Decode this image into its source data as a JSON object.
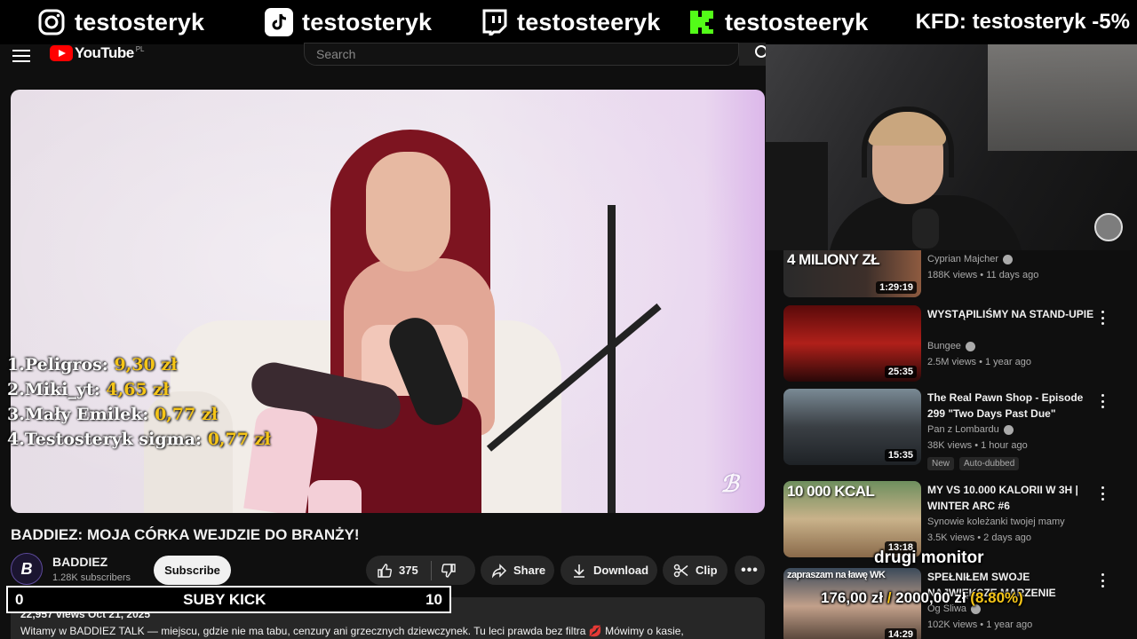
{
  "banner": {
    "instagram_name": "testosteryk",
    "tiktok_name": "testosteryk",
    "twitch_name": "testosteeryk",
    "kick_name": "testosteeryk",
    "kfd_text": "KFD: testosteryk -5%"
  },
  "youtube": {
    "logo_text": "YouTube",
    "logo_region": "PL",
    "search_placeholder": "Search"
  },
  "leaderboard": [
    {
      "label": "1.Peligros:",
      "amount": "9,30 zł"
    },
    {
      "label": "2.Miki_yt:",
      "amount": "4,65 zł"
    },
    {
      "label": "3.Mały Emilek:",
      "amount": "0,77 zł"
    },
    {
      "label": "4.Testosteryk sigma:",
      "amount": "0,77 zł"
    }
  ],
  "video": {
    "title": "BADDIEZ: MOJA CÓRKA WEJDZIE DO BRANŻY!",
    "channel": "BADDIEZ",
    "subscribers": "1.28K subscribers",
    "subscribe_label": "Subscribe",
    "likes": "375",
    "share_label": "Share",
    "download_label": "Download",
    "clip_label": "Clip",
    "meta": "22,957 views  Oct 21, 2025",
    "description": "Witamy w BADDIEZ TALK — miejscu, gdzie nie ma tabu, cenzury ani grzecznych dziewczynek. Tu leci prawda bez filtra 💋 Mówimy o kasie,"
  },
  "suby": {
    "left": "0",
    "label": "SUBY KICK",
    "right": "10"
  },
  "recommendations": [
    {
      "thumb_text": "4 MILIONY ZŁ",
      "duration": "1:29:19",
      "title": "",
      "channel": "Cyprian Majcher",
      "verified": true,
      "meta": "188K views • 11 days ago"
    },
    {
      "thumb_text": "",
      "duration": "25:35",
      "title": "WYSTĄPILIŚMY NA STAND-UPIE",
      "channel": "Bungee",
      "verified": true,
      "meta": "2.5M views • 1 year ago"
    },
    {
      "thumb_text": "",
      "duration": "15:35",
      "title": "The Real Pawn Shop - Episode 299 \"Two Days Past Due\"",
      "channel": "Pan z Lombardu",
      "verified": true,
      "meta": "38K views • 1 hour ago",
      "badges": [
        "New",
        "Auto-dubbed"
      ]
    },
    {
      "thumb_text": "10 000 KCAL",
      "duration": "13:18",
      "title": "MY VS 10.000 KALORII W 3H | WINTER ARC #6",
      "channel": "Synowie koleżanki twojej mamy",
      "verified": false,
      "meta": "3.5K views • 2 days ago"
    },
    {
      "thumb_text": "zapraszam na ławę WK",
      "duration": "14:29",
      "title": "SPEŁNIŁEM SWOJE NAJWIĘKSZE MARZENIE",
      "channel": "Og Śliwa",
      "verified": true,
      "meta": "102K views • 1 year ago"
    }
  ],
  "drugi_monitor": {
    "label": "drugi monitor",
    "current": "176,00 zł",
    "separator": "/",
    "goal": "2000,00 zł",
    "percent": "(8.80%)"
  },
  "colors": {
    "youtube_red": "#ff0000",
    "donation_gold": "#f5c518",
    "kick_green": "#53fc18",
    "twitch_purple": "#9146ff"
  }
}
